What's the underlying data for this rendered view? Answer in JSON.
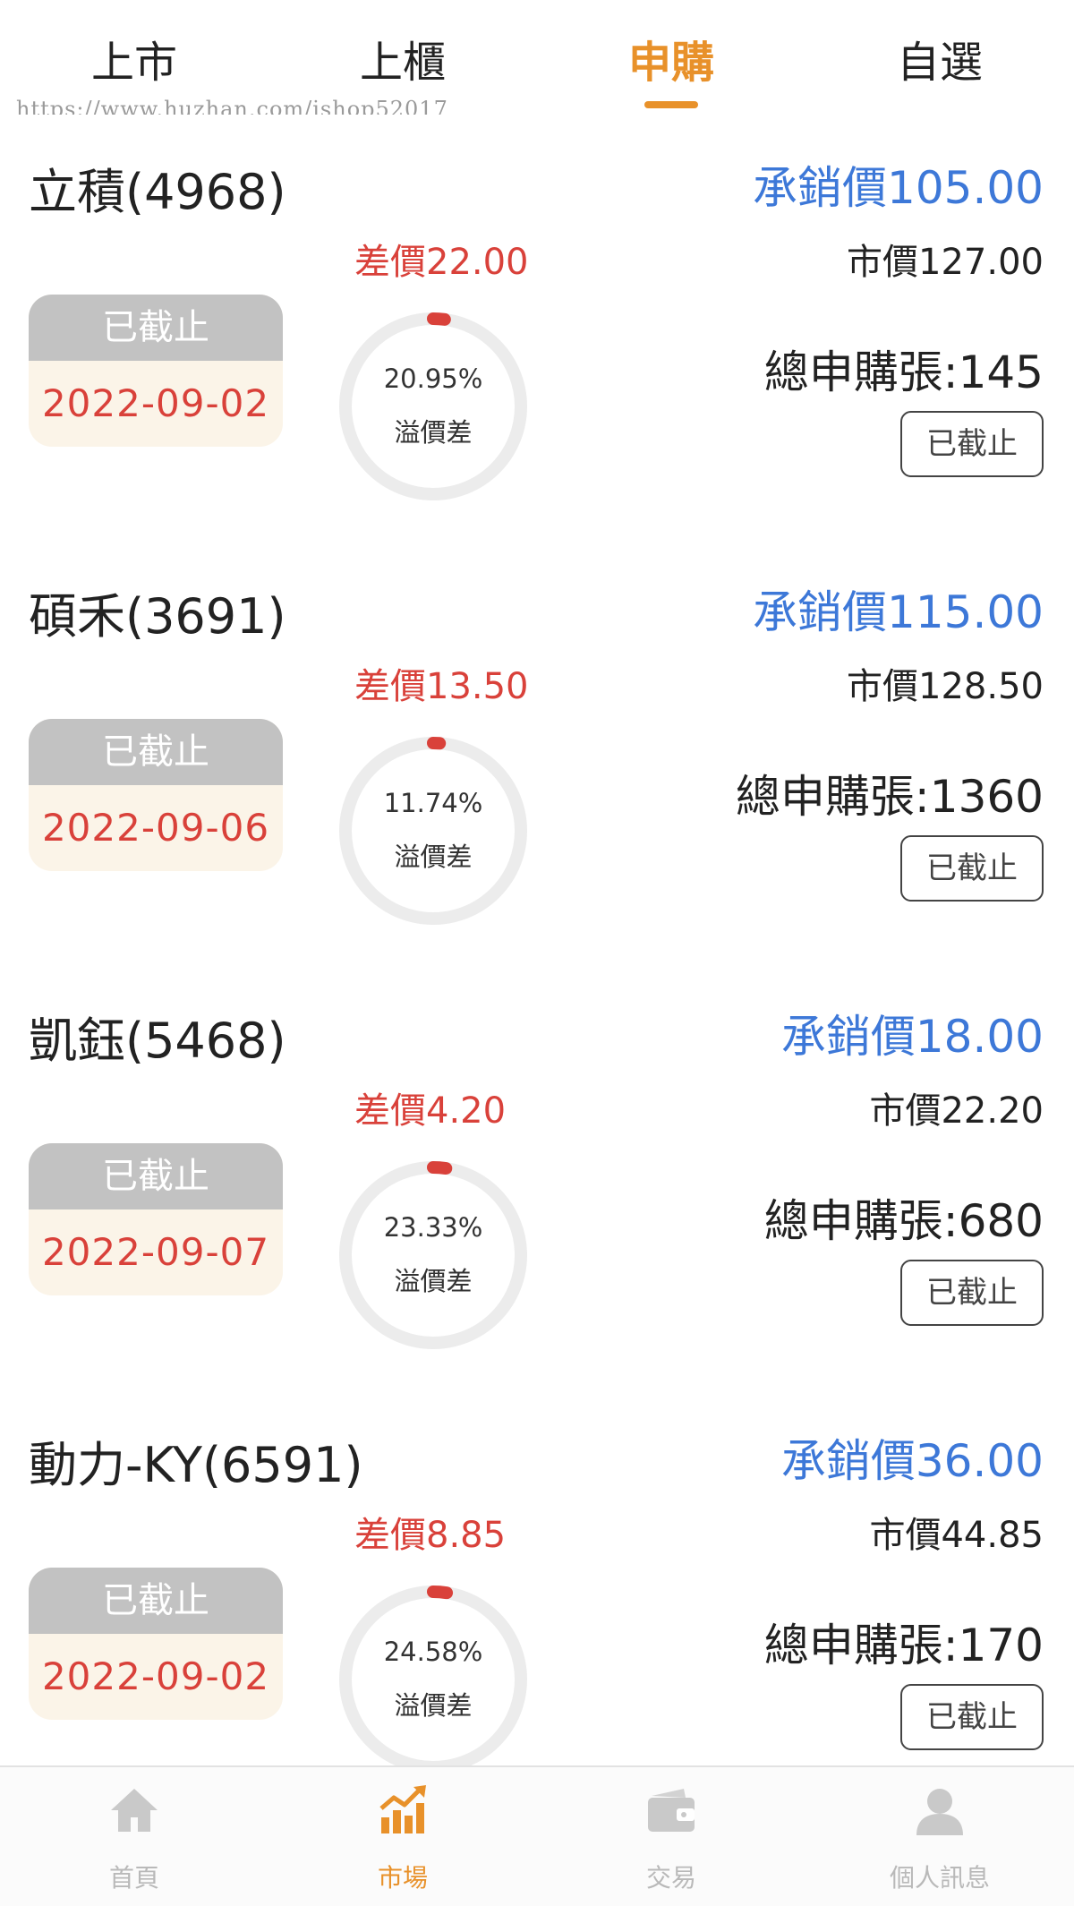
{
  "tabs": {
    "items": [
      {
        "label": "上市",
        "active": false
      },
      {
        "label": "上櫃",
        "active": false
      },
      {
        "label": "申購",
        "active": true
      },
      {
        "label": "自選",
        "active": false
      }
    ],
    "accent_color": "#e8912a"
  },
  "watermark": "https://www.huzhan.com/ishop52017",
  "subscriptions": [
    {
      "name": "立積(4968)",
      "underwriting_price": "承銷價105.00",
      "price_difference": "差價22.00",
      "market_price": "市價127.00",
      "status": "已截止",
      "date": "2022-09-02",
      "premium_percent": "20.95%",
      "premium_value": 20.95,
      "premium_label": "溢價差",
      "total_applications": "總申購張:145",
      "action_label": "已截止"
    },
    {
      "name": "碩禾(3691)",
      "underwriting_price": "承銷價115.00",
      "price_difference": "差價13.50",
      "market_price": "市價128.50",
      "status": "已截止",
      "date": "2022-09-06",
      "premium_percent": "11.74%",
      "premium_value": 11.74,
      "premium_label": "溢價差",
      "total_applications": "總申購張:1360",
      "action_label": "已截止"
    },
    {
      "name": "凱鈺(5468)",
      "underwriting_price": "承銷價18.00",
      "price_difference": "差價4.20",
      "market_price": "市價22.20",
      "status": "已截止",
      "date": "2022-09-07",
      "premium_percent": "23.33%",
      "premium_value": 23.33,
      "premium_label": "溢價差",
      "total_applications": "總申購張:680",
      "action_label": "已截止"
    },
    {
      "name": "動力-KY(6591)",
      "underwriting_price": "承銷價36.00",
      "price_difference": "差價8.85",
      "market_price": "市價44.85",
      "status": "已截止",
      "date": "2022-09-02",
      "premium_percent": "24.58%",
      "premium_value": 24.58,
      "premium_label": "溢價差",
      "total_applications": "總申購張:170",
      "action_label": "已截止"
    }
  ],
  "bottom_nav": {
    "items": [
      {
        "label": "首頁",
        "icon": "home-icon",
        "active": false
      },
      {
        "label": "市場",
        "icon": "chart-icon",
        "active": true
      },
      {
        "label": "交易",
        "icon": "wallet-icon",
        "active": false
      },
      {
        "label": "個人訊息",
        "icon": "person-icon",
        "active": false
      }
    ]
  },
  "colors": {
    "accent": "#e8912a",
    "underwriting_blue": "#3d78d8",
    "difference_red": "#d9413a",
    "status_gray": "#c2c2c2",
    "date_background": "#fbf4e8"
  }
}
